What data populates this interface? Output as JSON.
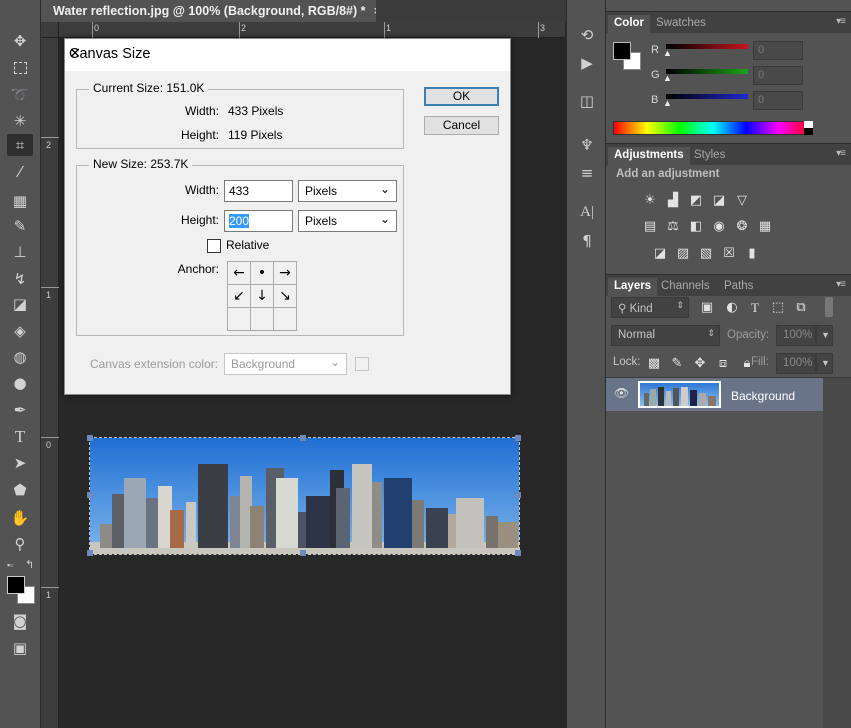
{
  "document": {
    "tab_title": "Water reflection.jpg @ 100% (Background, RGB/8#) *",
    "tab_close": "×",
    "ruler_top": [
      "0",
      "1",
      "2",
      "3"
    ],
    "ruler_left": [
      "2",
      "1",
      "0",
      "1"
    ]
  },
  "toolbar": {
    "tools": [
      "move-tool",
      "marquee-tool",
      "lasso-tool",
      "quick-select-tool",
      "crop-tool",
      "eyedropper-tool",
      "healing-brush-tool",
      "brush-tool",
      "clone-stamp-tool",
      "history-brush-tool",
      "eraser-tool",
      "paint-bucket-tool",
      "blur-tool",
      "dodge-tool",
      "pen-tool",
      "type-tool",
      "path-select-tool",
      "shape-tool",
      "hand-tool",
      "zoom-tool",
      "color-swatches",
      "quick-mask",
      "screen-mode"
    ],
    "active_tool": "crop-tool"
  },
  "dialog": {
    "title": "Canvas Size",
    "close": "✕",
    "current_size_label": "Current Size: 151.0K",
    "current_width_label": "Width:",
    "current_width_value": "433 Pixels",
    "current_height_label": "Height:",
    "current_height_value": "119 Pixels",
    "new_size_label": "New Size: 253.7K",
    "width_label": "Width:",
    "width_value": "433",
    "width_unit": "Pixels",
    "height_label": "Height:",
    "height_value": "200",
    "height_unit": "Pixels",
    "relative_label": "Relative",
    "relative_checked": false,
    "anchor_label": "Anchor:",
    "anchor_arrows": [
      "←",
      "•",
      "→",
      "↙",
      "↓",
      "↘",
      "",
      "",
      ""
    ],
    "extension_color_label": "Canvas extension color:",
    "extension_color_value": "Background",
    "ok_label": "OK",
    "cancel_label": "Cancel"
  },
  "color_panel": {
    "tabs": [
      "Color",
      "Swatches"
    ],
    "active_tab": "Color",
    "channels": [
      {
        "label": "R",
        "value": "0",
        "color": "#c8141e"
      },
      {
        "label": "G",
        "value": "0",
        "color": "#19a519"
      },
      {
        "label": "B",
        "value": "0",
        "color": "#1e28d2"
      }
    ],
    "foreground": "#000000",
    "background": "#ffffff"
  },
  "adjustments_panel": {
    "tabs": [
      "Adjustments",
      "Styles"
    ],
    "active_tab": "Adjustments",
    "heading": "Add an adjustment",
    "icons": [
      "brightness-contrast-icon",
      "levels-icon",
      "curves-icon",
      "exposure-icon",
      "vibrance-icon",
      "hue-saturation-icon",
      "color-balance-icon",
      "black-white-icon",
      "photo-filter-icon",
      "channel-mixer-icon",
      "color-lookup-icon",
      "invert-icon",
      "posterize-icon",
      "threshold-icon",
      "selective-color-icon",
      "gradient-map-icon"
    ]
  },
  "layers_panel": {
    "tabs": [
      "Layers",
      "Channels",
      "Paths"
    ],
    "active_tab": "Layers",
    "filter_label": "Kind",
    "blend_mode": "Normal",
    "opacity_label": "Opacity:",
    "opacity_value": "100%",
    "lock_label": "Lock:",
    "fill_label": "Fill:",
    "fill_value": "100%",
    "layers": [
      {
        "name": "Background",
        "visible": true,
        "selected": true
      }
    ]
  }
}
